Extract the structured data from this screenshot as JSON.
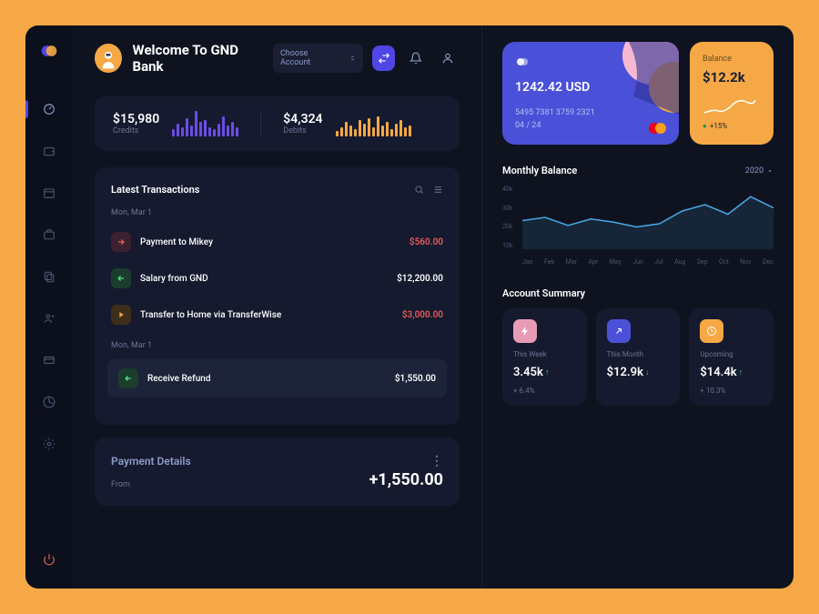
{
  "header": {
    "welcome": "Welcome To GND Bank",
    "account_select": "Choose Account"
  },
  "stats": {
    "credits": {
      "value": "$15,980",
      "label": "Credits"
    },
    "debits": {
      "value": "$4,324",
      "label": "Debits"
    }
  },
  "transactions": {
    "title": "Latest Transactions",
    "date1": "Mon, Mar 1",
    "date2": "Mon, Mar 1",
    "items": [
      {
        "name": "Payment to Mikey",
        "amount": "$560.00"
      },
      {
        "name": "Salary from GND",
        "amount": "$12,200.00"
      },
      {
        "name": "Transfer to Home via TransferWise",
        "amount": "$3,000.00"
      },
      {
        "name": "Receive Refund",
        "amount": "$1,550.00"
      }
    ]
  },
  "payment_details": {
    "title": "Payment Details",
    "from_label": "From",
    "amount": "+1,550.00"
  },
  "card": {
    "amount": "1242.42 USD",
    "number": "5495 7381 3759 2321",
    "expiry": "04 / 24"
  },
  "balance_card": {
    "label": "Balance",
    "value": "$12.2k",
    "change": "+15%"
  },
  "monthly_balance": {
    "title": "Monthly Balance",
    "year": "2020"
  },
  "chart_data": {
    "type": "line",
    "title": "Monthly Balance",
    "xlabel": "",
    "ylabel": "",
    "ylim": [
      0,
      40
    ],
    "y_ticks": [
      "40k",
      "30k",
      "20k",
      "10k"
    ],
    "categories": [
      "Jan",
      "Feb",
      "Mar",
      "Apr",
      "May",
      "Jun",
      "Jul",
      "Aug",
      "Sep",
      "Oct",
      "Nov",
      "Dec"
    ],
    "series": [
      {
        "name": "balance",
        "values": [
          18,
          20,
          15,
          19,
          17,
          14,
          16,
          24,
          28,
          22,
          33,
          26
        ]
      }
    ]
  },
  "account_summary": {
    "title": "Account Summary",
    "cards": [
      {
        "label": "This Week",
        "value": "3.45k",
        "change": "+ 6.4%",
        "dir": "up"
      },
      {
        "label": "This Month",
        "value": "$12.9k",
        "change": "",
        "dir": "down"
      },
      {
        "label": "Upcoming",
        "value": "$14.4k",
        "change": "+ 10.3%",
        "dir": "up"
      }
    ]
  },
  "chart_bars": {
    "purple": [
      8,
      14,
      10,
      20,
      12,
      28,
      16,
      18,
      10,
      8,
      14,
      22,
      12,
      16,
      10
    ],
    "orange": [
      6,
      10,
      16,
      12,
      8,
      18,
      14,
      20,
      10,
      22,
      12,
      16,
      8,
      14,
      18,
      10,
      12
    ]
  }
}
